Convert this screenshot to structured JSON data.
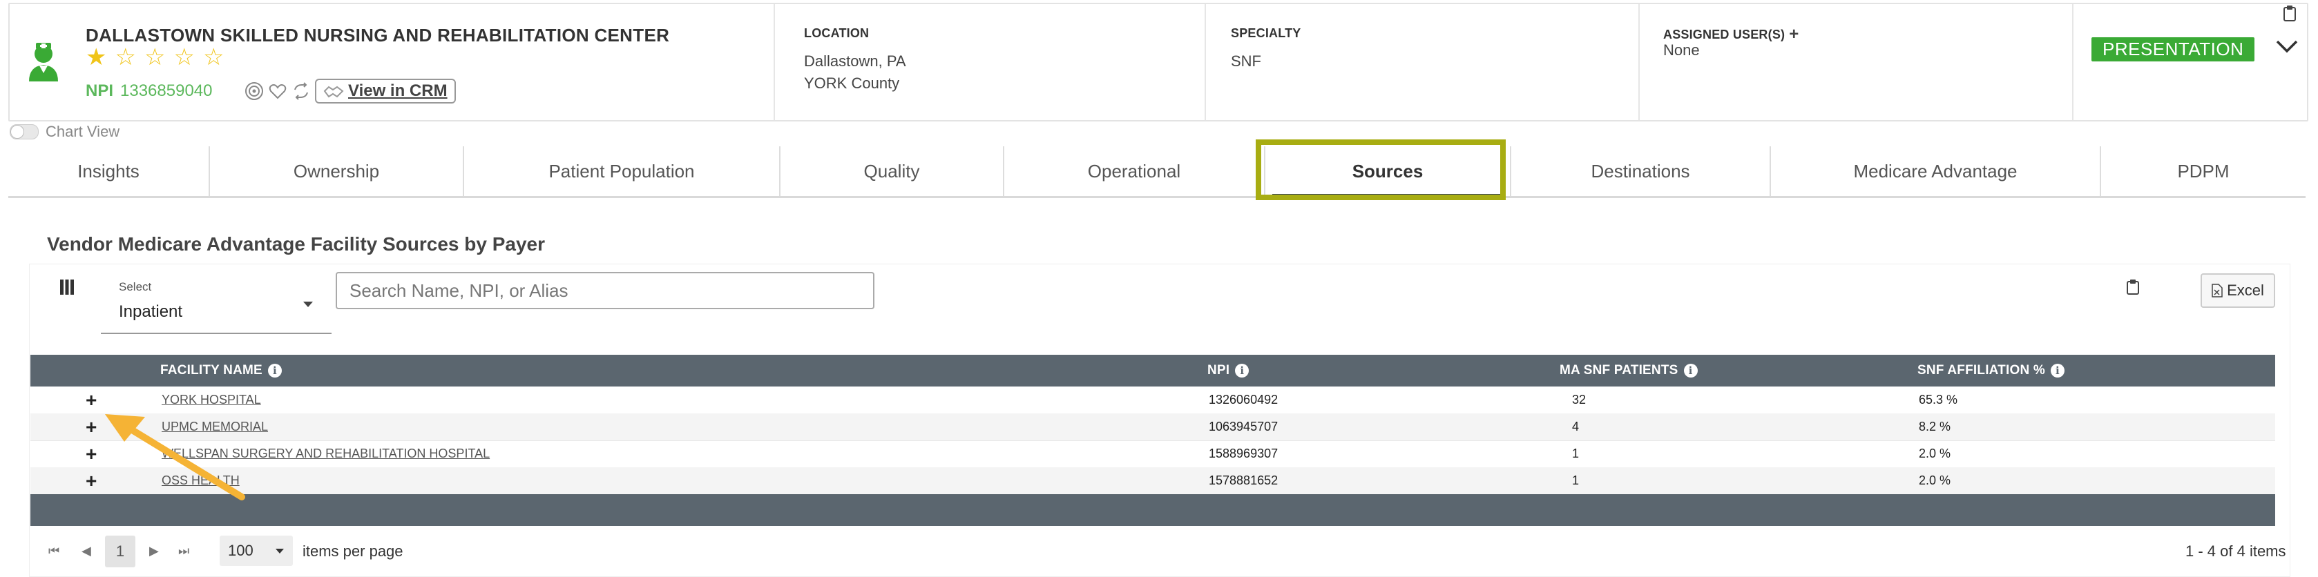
{
  "header": {
    "facility_name": "DALLASTOWN SKILLED NURSING AND REHABILITATION CENTER",
    "rating_stars": 1,
    "rating_max": 5,
    "npi_label": "NPI",
    "npi_value": "1336859040",
    "crm_button_label": "View in CRM",
    "location": {
      "label": "LOCATION",
      "line1": "Dallastown, PA",
      "line2": "YORK County"
    },
    "specialty": {
      "label": "SPECIALTY",
      "value": "SNF"
    },
    "assigned": {
      "label": "ASSIGNED USER(S)",
      "value": "None"
    },
    "status_badge": "PRESENTATION"
  },
  "chart_view_label": "Chart View",
  "tabs": [
    {
      "label": "Insights"
    },
    {
      "label": "Ownership"
    },
    {
      "label": "Patient Population"
    },
    {
      "label": "Quality"
    },
    {
      "label": "Operational"
    },
    {
      "label": "Sources",
      "active": true
    },
    {
      "label": "Destinations"
    },
    {
      "label": "Medicare Advantage"
    },
    {
      "label": "PDPM"
    }
  ],
  "section": {
    "title": "Vendor Medicare Advantage Facility Sources by Payer",
    "select_label": "Select",
    "select_value": "Inpatient",
    "search_placeholder": "Search Name, NPI, or Alias",
    "excel_label": "Excel"
  },
  "table": {
    "columns": [
      "FACILITY NAME",
      "NPI",
      "MA SNF PATIENTS",
      "SNF AFFILIATION %"
    ],
    "rows": [
      {
        "name": "YORK HOSPITAL",
        "npi": "1326060492",
        "patients": "32",
        "affiliation": "65.3 %"
      },
      {
        "name": "UPMC MEMORIAL",
        "npi": "1063945707",
        "patients": "4",
        "affiliation": "8.2 %"
      },
      {
        "name": "WELLSPAN SURGERY AND REHABILITATION HOSPITAL",
        "npi": "1588969307",
        "patients": "1",
        "affiliation": "2.0 %"
      },
      {
        "name": "OSS HEALTH",
        "npi": "1578881652",
        "patients": "1",
        "affiliation": "2.0 %"
      }
    ]
  },
  "pager": {
    "current_page": "1",
    "per_page": "100",
    "per_page_label": "items per page",
    "summary": "1 - 4 of 4 items"
  },
  "colors": {
    "brand_green": "#3aaa35",
    "highlight": "#a8ad12",
    "table_header": "#5b666f",
    "annotation_arrow": "#f5b335"
  }
}
